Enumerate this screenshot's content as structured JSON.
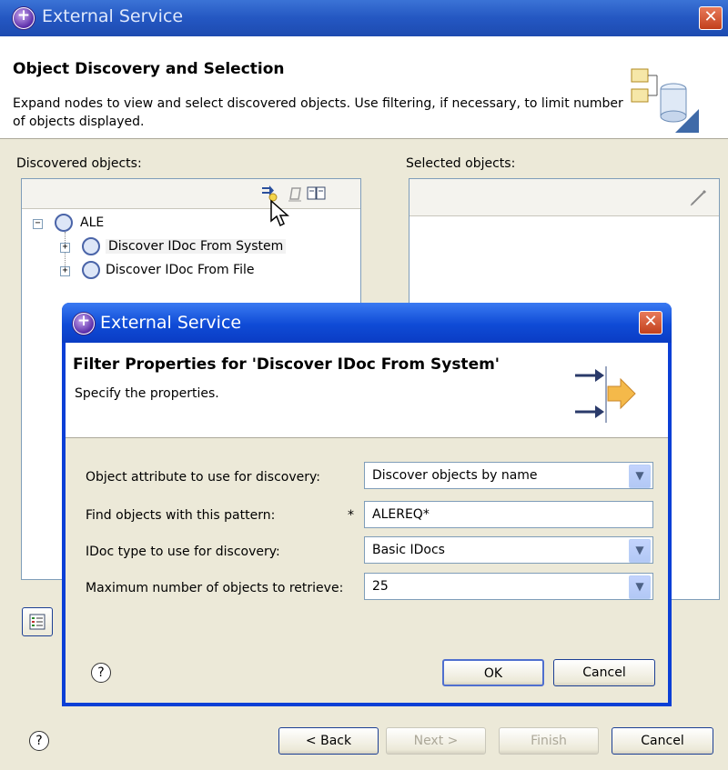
{
  "window": {
    "title": "External Service",
    "close_label": "✕"
  },
  "header": {
    "title": "Object Discovery and Selection",
    "description": "Expand nodes to view and select discovered objects.  Use filtering, if necessary, to limit number of objects displayed."
  },
  "discovered": {
    "label": "Discovered objects:",
    "tree": {
      "root": {
        "label": "ALE",
        "expander": "−"
      },
      "children": [
        {
          "label": "Discover IDoc From System",
          "expander": "+"
        },
        {
          "label": "Discover IDoc From File",
          "expander": "+"
        }
      ]
    }
  },
  "selected": {
    "label": "Selected objects:"
  },
  "footer": {
    "help": "?",
    "back": "< Back",
    "next": "Next >",
    "finish": "Finish",
    "cancel": "Cancel"
  },
  "dialog": {
    "title": "External Service",
    "close_label": "✕",
    "heading": "Filter Properties for 'Discover IDoc From System'",
    "subheading": "Specify the properties.",
    "fields": [
      {
        "label": "Object attribute to use for discovery:",
        "value": "Discover objects by name",
        "required": ""
      },
      {
        "label": "Find objects with this pattern:",
        "value": "ALEREQ*",
        "required": "*"
      },
      {
        "label": "IDoc type to use for discovery:",
        "value": "Basic IDocs",
        "required": ""
      },
      {
        "label": "Maximum number of objects to retrieve:",
        "value": "25",
        "required": ""
      }
    ],
    "ok": "OK",
    "cancel": "Cancel",
    "help": "?"
  }
}
